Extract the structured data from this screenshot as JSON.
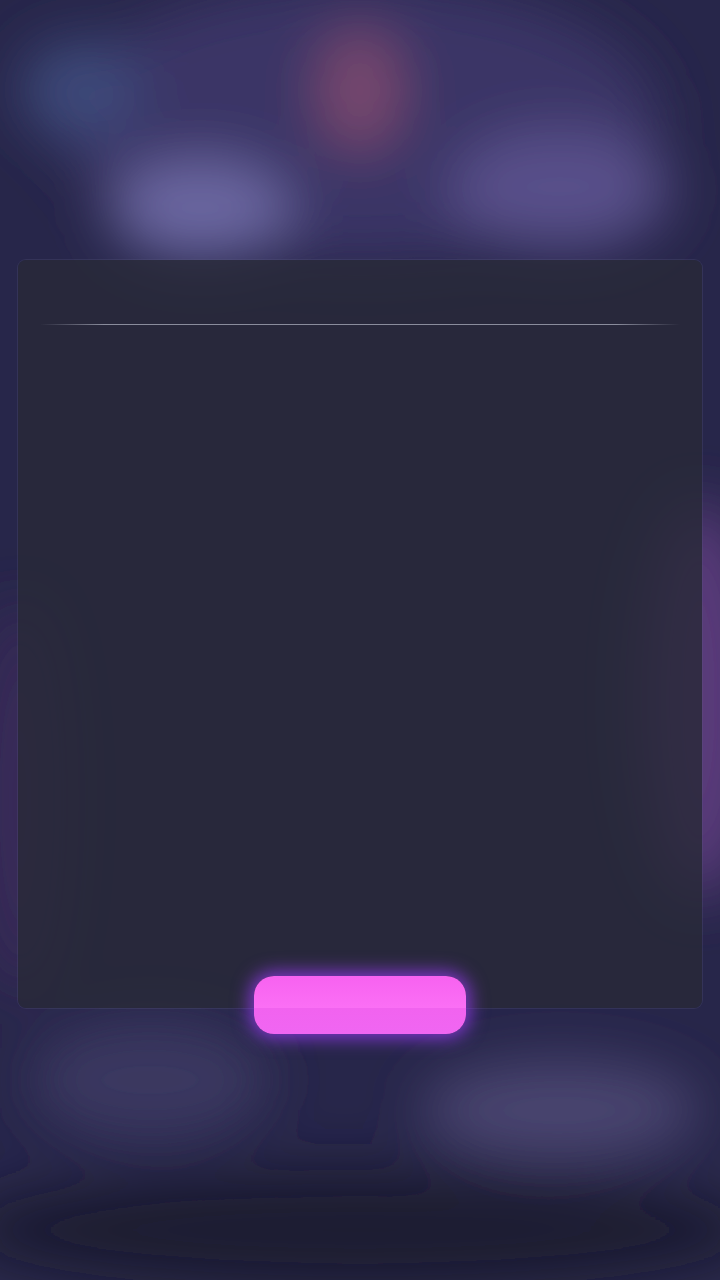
{
  "dialog": {
    "kind": "panel",
    "button": {
      "kind": "primary"
    }
  }
}
